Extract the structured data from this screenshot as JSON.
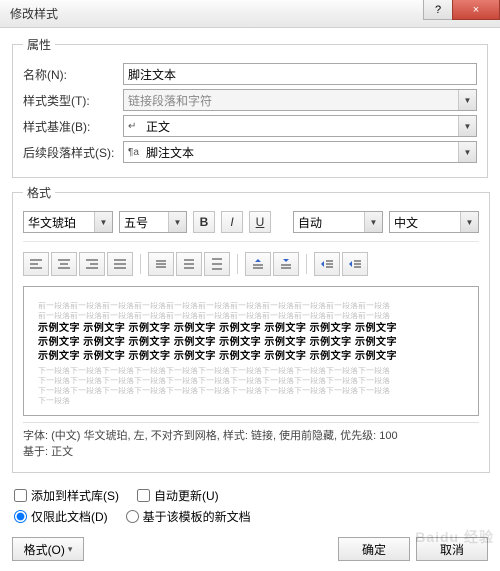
{
  "window": {
    "title": "修改样式",
    "help": "?",
    "close": "×"
  },
  "sections": {
    "properties": "属性",
    "format": "格式"
  },
  "labels": {
    "name": "名称(N):",
    "styleType": "样式类型(T):",
    "basedOn": "样式基准(B):",
    "followingStyle": "后续段落样式(S):"
  },
  "values": {
    "name": "脚注文本",
    "styleType": "链接段落和字符",
    "basedOn": "正文",
    "followingStyle": "脚注文本",
    "font": "华文琥珀",
    "size": "五号",
    "autoColor": "自动",
    "script": "中文"
  },
  "buttons": {
    "bold": "B",
    "italic": "I",
    "underline": "U"
  },
  "preview": {
    "grey": "前一段落前一段落前一段落前一段落前一段落前一段落前一段落前一段落前一段落前一段落前一段落",
    "bold": "示例文字 示例文字 示例文字 示例文字 示例文字 示例文字 示例文字 示例文字",
    "after": "下一段落下一段落下一段落下一段落下一段落下一段落下一段落下一段落下一段落下一段落下一段落",
    "afterShort": "下一段落"
  },
  "description": {
    "line1": "字体: (中文) 华文琥珀, 左, 不对齐到网格, 样式: 链接, 使用前隐藏, 优先级: 100",
    "line2": "基于: 正文"
  },
  "options": {
    "addToGallery": "添加到样式库(S)",
    "autoUpdate": "自动更新(U)",
    "onlyThisDoc": "仅限此文档(D)",
    "newDocsTemplate": "基于该模板的新文档"
  },
  "footer": {
    "formatBtn": "格式(O)",
    "ok": "确定",
    "cancel": "取消"
  }
}
